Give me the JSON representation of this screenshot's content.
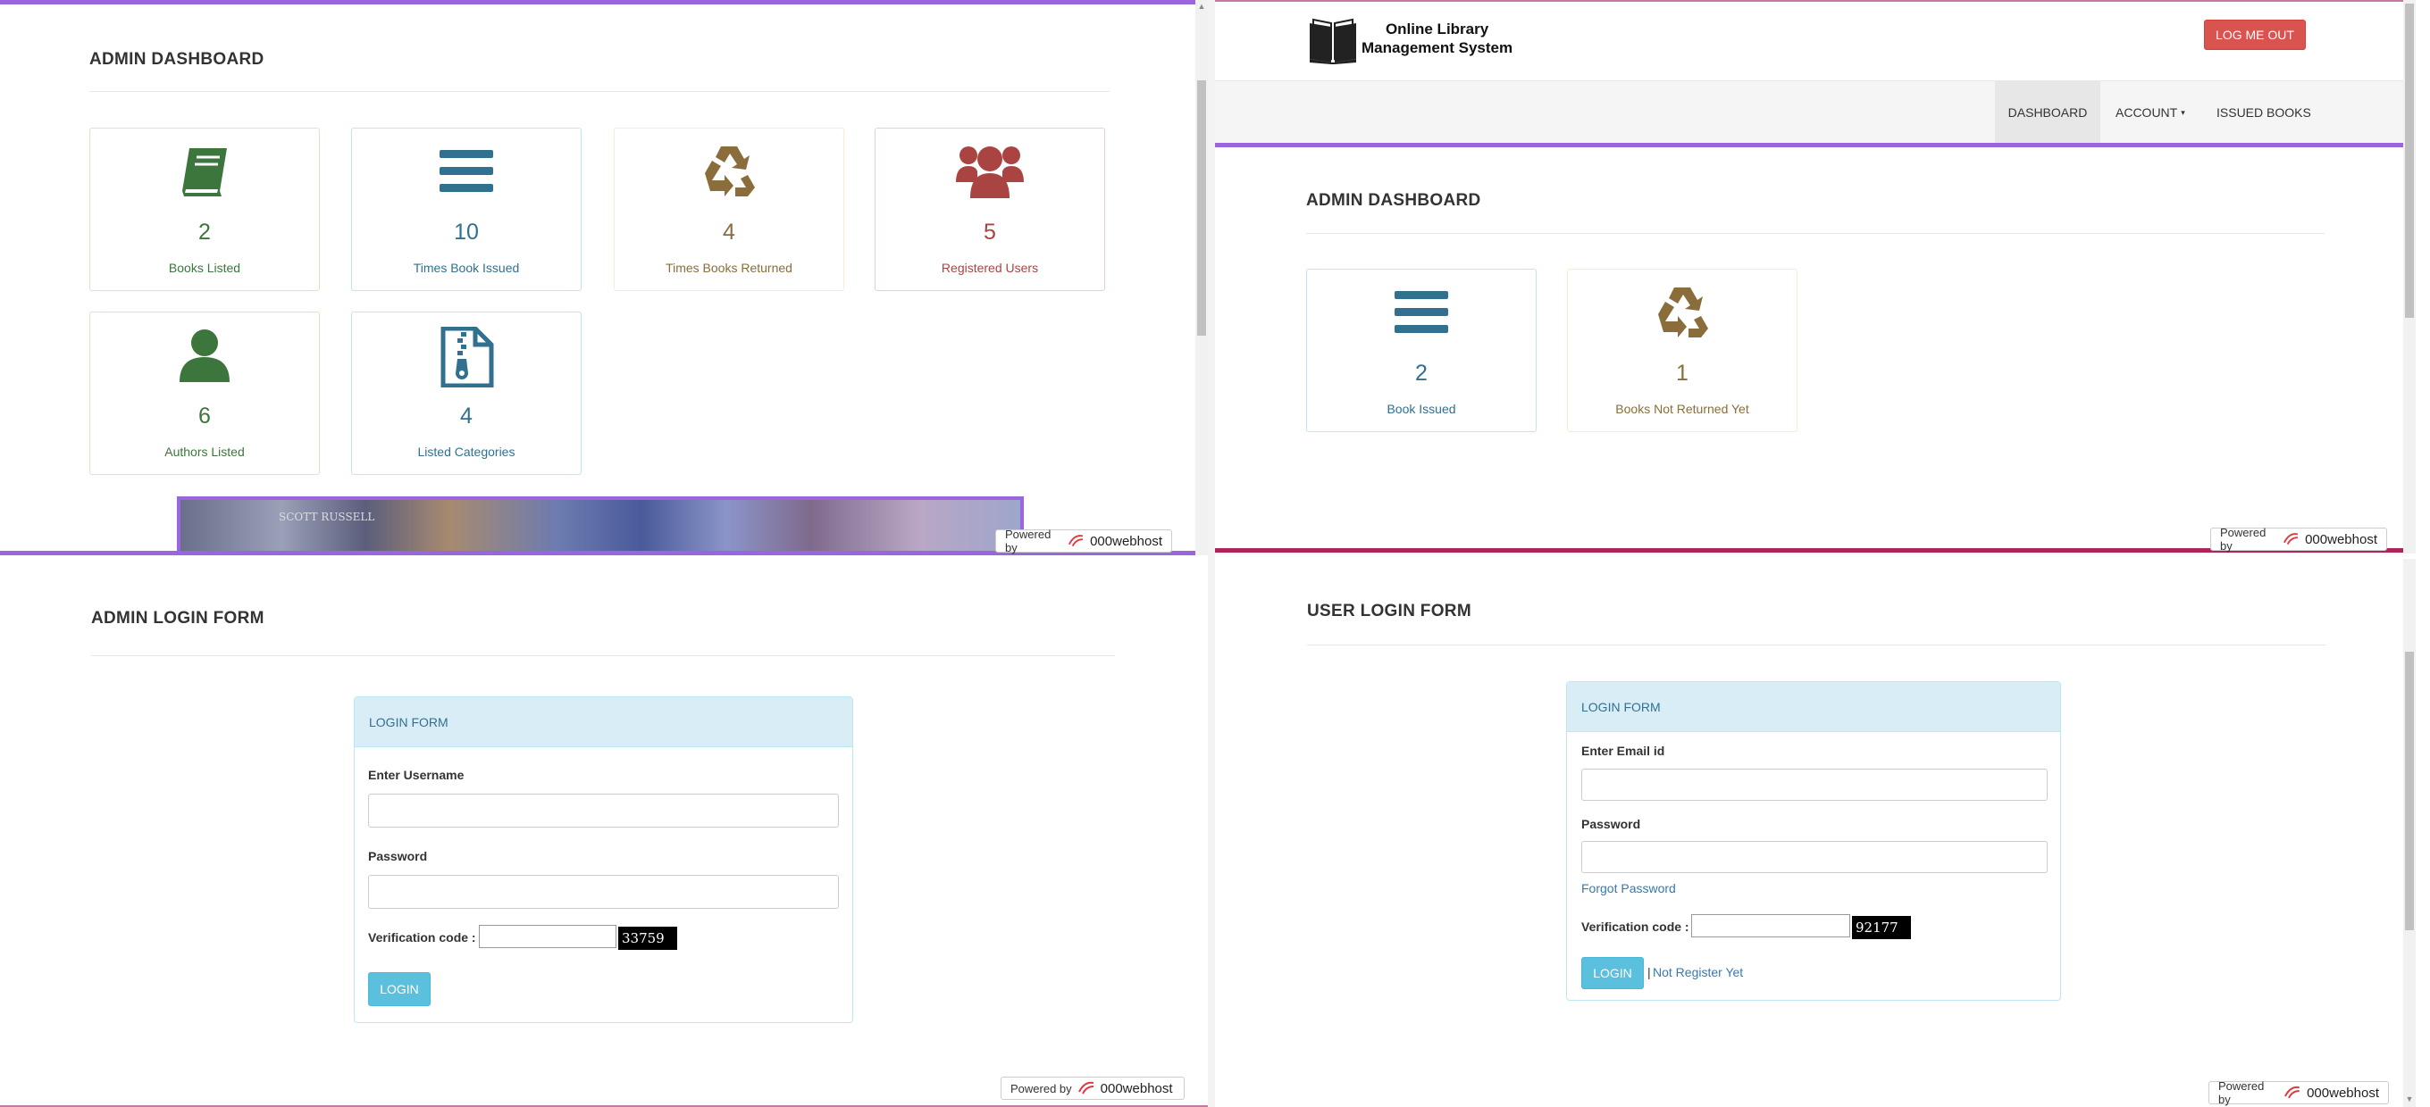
{
  "admin_dashboard": {
    "heading": "ADMIN DASHBOARD",
    "cards": [
      {
        "value": "2",
        "label": "Books Listed",
        "icon": "book-icon"
      },
      {
        "value": "10",
        "label": "Times Book Issued",
        "icon": "bars-icon"
      },
      {
        "value": "4",
        "label": "Times Books Returned",
        "icon": "recycle-icon"
      },
      {
        "value": "5",
        "label": "Registered Users",
        "icon": "users-icon"
      },
      {
        "value": "6",
        "label": "Authors Listed",
        "icon": "user-icon"
      },
      {
        "value": "4",
        "label": "Listed Categories",
        "icon": "file-archive-icon"
      }
    ],
    "banner_text": "SCOTT RUSSELL"
  },
  "user_dashboard": {
    "brand_line1": "Online Library",
    "brand_line2": "Management System",
    "logout_label": "LOG ME OUT",
    "nav": {
      "dashboard": "DASHBOARD",
      "account": "ACCOUNT",
      "issued": "ISSUED BOOKS"
    },
    "heading": "ADMIN DASHBOARD",
    "cards": [
      {
        "value": "2",
        "label": "Book Issued",
        "icon": "bars-icon"
      },
      {
        "value": "1",
        "label": "Books Not Returned Yet",
        "icon": "recycle-icon"
      }
    ]
  },
  "admin_login": {
    "heading": "ADMIN LOGIN FORM",
    "panel_title": "LOGIN FORM",
    "username_label": "Enter Username",
    "password_label": "Password",
    "verification_label": "Verification code :",
    "captcha": "33759",
    "login_label": "LOGIN"
  },
  "user_login": {
    "heading": "USER LOGIN FORM",
    "panel_title": "LOGIN FORM",
    "email_label": "Enter Email id",
    "password_label": "Password",
    "forgot_label": "Forgot Password",
    "verification_label": "Verification code :",
    "captcha": "92177",
    "login_label": "LOGIN",
    "separator": "|",
    "register_label": "Not Register Yet"
  },
  "powered": {
    "prefix": "Powered by",
    "brand": "000webhost"
  },
  "colors": {
    "green": "#3c763d",
    "blue": "#31708f",
    "gold": "#8a6d3b",
    "red": "#a94442",
    "purple_rule": "#9966e0",
    "info_button": "#5bc0de",
    "danger_button": "#d9534f"
  }
}
